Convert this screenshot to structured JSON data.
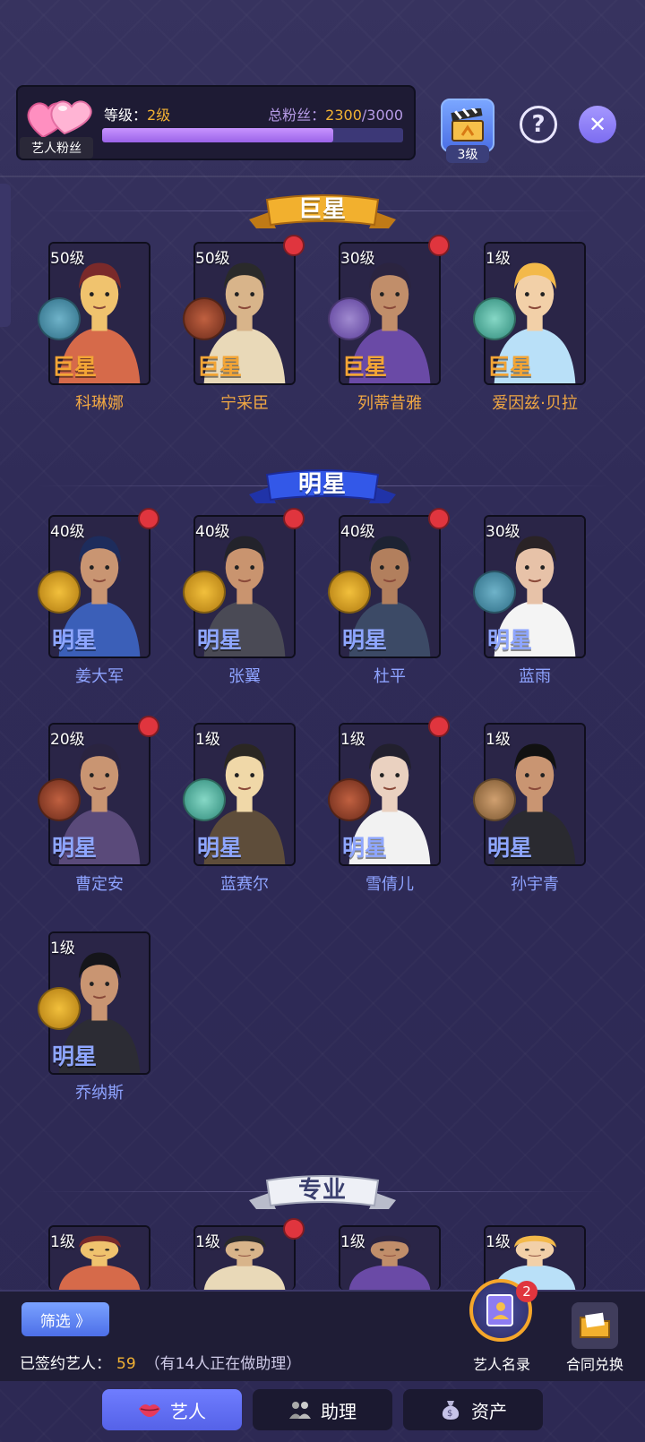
{
  "header": {
    "fan_tag": "艺人粉丝",
    "level_label": "等级：",
    "level_value": "2级",
    "fans_label": "总粉丝：",
    "fans_value": "2300",
    "fans_total": "/3000",
    "progress_fraction": 0.767,
    "clapper_level": "3级",
    "help_symbol": "?",
    "close_symbol": "✕"
  },
  "sections": {
    "superstar": "巨星",
    "star": "明星",
    "pro": "专业"
  },
  "superstars": [
    {
      "level": "50级",
      "tier": "巨星",
      "name": "科琳娜",
      "badge": "ufo",
      "dot": false
    },
    {
      "level": "50级",
      "tier": "巨星",
      "name": "宁采臣",
      "badge": "silhouette-red",
      "dot": true
    },
    {
      "level": "30级",
      "tier": "巨星",
      "name": "列蒂昔雅",
      "badge": "racket",
      "dot": true
    },
    {
      "level": "1级",
      "tier": "巨星",
      "name": "爱因兹·贝拉",
      "badge": "dancer",
      "dot": false
    }
  ],
  "stars": [
    {
      "level": "40级",
      "tier": "明星",
      "name": "姜大军",
      "badge": "soldier",
      "dot": true
    },
    {
      "level": "40级",
      "tier": "明星",
      "name": "张翼",
      "badge": "soldier",
      "dot": true
    },
    {
      "level": "40级",
      "tier": "明星",
      "name": "杜平",
      "badge": "soldier",
      "dot": true
    },
    {
      "level": "30级",
      "tier": "明星",
      "name": "蓝雨",
      "badge": "ufo",
      "dot": false
    },
    {
      "level": "20级",
      "tier": "明星",
      "name": "曹定安",
      "badge": "silhouette-red",
      "dot": true
    },
    {
      "level": "1级",
      "tier": "明星",
      "name": "蓝赛尔",
      "badge": "dancer",
      "dot": false
    },
    {
      "level": "1级",
      "tier": "明星",
      "name": "雪倩儿",
      "badge": "silhouette-red",
      "dot": true
    },
    {
      "level": "1级",
      "tier": "明星",
      "name": "孙宇青",
      "badge": "camera",
      "dot": false
    },
    {
      "level": "1级",
      "tier": "明星",
      "name": "乔纳斯",
      "badge": "soldier",
      "dot": false
    }
  ],
  "pros": [
    {
      "level": "1级",
      "dot": false
    },
    {
      "level": "1级",
      "dot": true
    },
    {
      "level": "1级",
      "dot": false
    },
    {
      "level": "1级",
      "dot": false
    }
  ],
  "bottom": {
    "filter_label": "筛选 》",
    "signed_label": "已签约艺人：",
    "signed_count": "59",
    "assistant_note": "（有14人正在做助理）",
    "directory_label": "艺人名录",
    "directory_badge": "2",
    "contract_label": "合同兑换"
  },
  "tabs": [
    {
      "label": "艺人",
      "active": true
    },
    {
      "label": "助理",
      "active": false
    },
    {
      "label": "资产",
      "active": false
    }
  ],
  "colors": {
    "gold": "#f3a536",
    "blue_tier": "#8ea6ff",
    "red_dot": "#e0353e",
    "tab_active": "#5f6cf2"
  }
}
